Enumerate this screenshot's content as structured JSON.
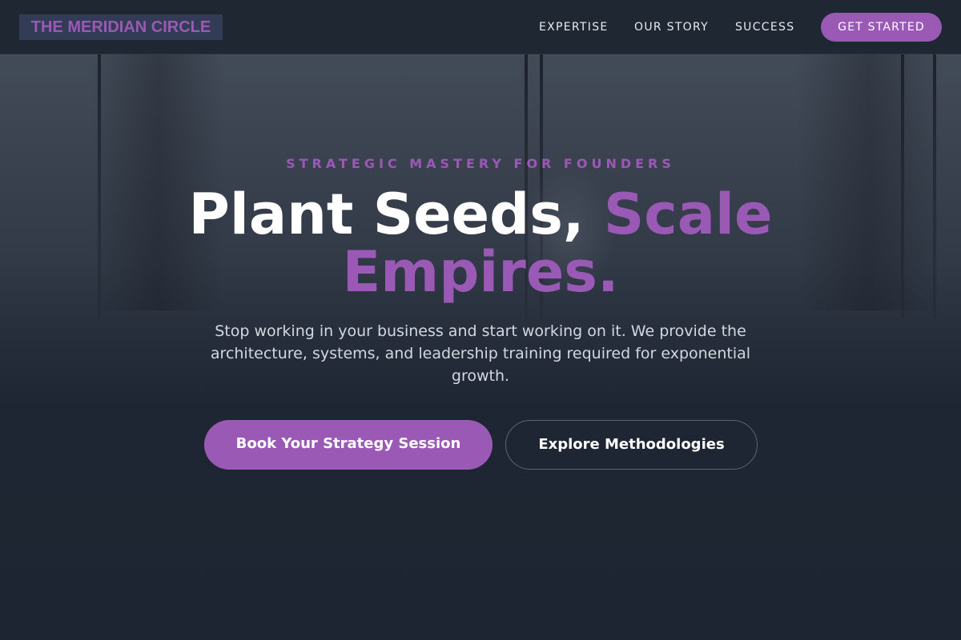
{
  "brand": {
    "name": "THE MERIDIAN CIRCLE",
    "accent_color": "#9b59b6",
    "background_color": "#1e2532"
  },
  "nav": {
    "links": [
      {
        "label": "EXPERTISE"
      },
      {
        "label": "OUR STORY"
      },
      {
        "label": "SUCCESS"
      }
    ],
    "cta_label": "GET STARTED"
  },
  "hero": {
    "eyebrow": "STRATEGIC MASTERY FOR FOUNDERS",
    "headline_plain": "Plant Seeds,",
    "headline_accent": "Scale Empires.",
    "subtext": "Stop working in your business and start working on it. We provide the architecture, systems, and leadership training required for exponential growth.",
    "primary_button": "Book Your Strategy Session",
    "secondary_button": "Explore Methodologies"
  }
}
